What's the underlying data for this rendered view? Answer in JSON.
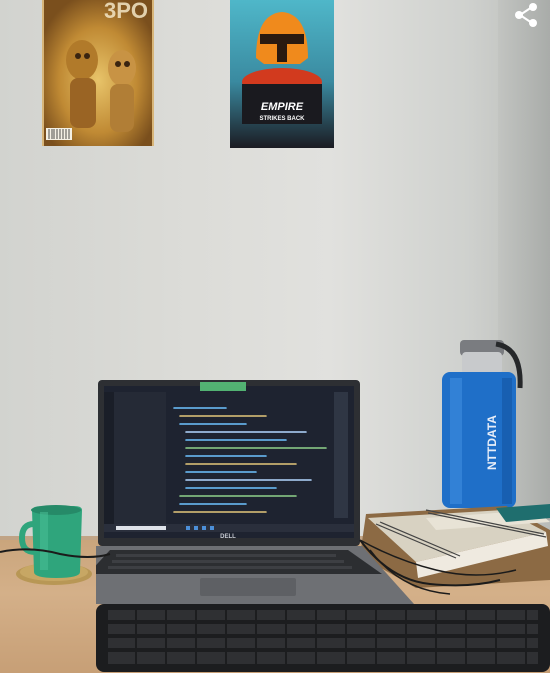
{
  "poster_left": {
    "title": "3PO"
  },
  "poster_right": {
    "line1": "EMPIRE",
    "line2": "STRIKES BACK"
  },
  "laptop": {
    "brand": "DELL"
  },
  "bottle": {
    "label": "NTTDATA"
  },
  "colors": {
    "wall": "#dcdcd8",
    "desk": "#d4b089",
    "bottle": "#1f6fc8",
    "mug": "#2fa57c",
    "screen": "#1e2330"
  },
  "icons": [
    "share-icon"
  ]
}
